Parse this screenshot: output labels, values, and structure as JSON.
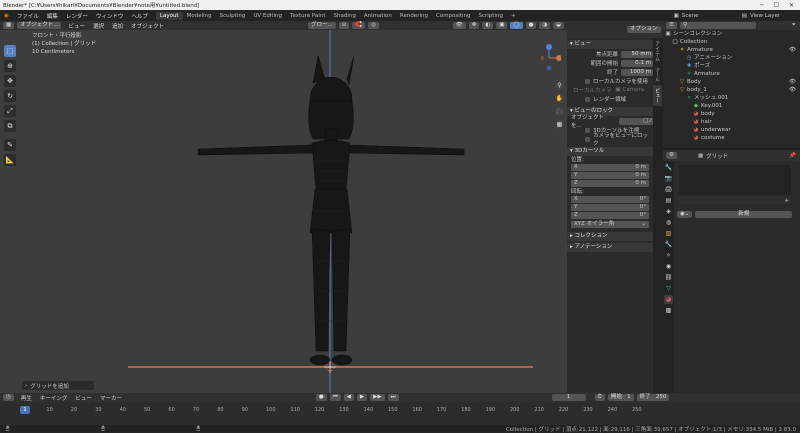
{
  "titlebar": {
    "title": "Blender* [C:¥Users¥hikari¥Documents¥Blender¥note用¥untitled.blend]"
  },
  "menu": [
    "ファイル",
    "編集",
    "レンダー",
    "ウィンドウ",
    "ヘルプ"
  ],
  "workspaces": [
    "Layout",
    "Modeling",
    "Sculpting",
    "UV Editing",
    "Texture Paint",
    "Shading",
    "Animation",
    "Rendering",
    "Compositing",
    "Scripting"
  ],
  "workspace_add": "+",
  "scene": {
    "label": "Scene",
    "view_layer": "View Layer",
    "options": "オプション"
  },
  "viewport": {
    "mode": "オブジェクト...",
    "menus": [
      "ビュー",
      "選択",
      "追加",
      "オブジェクト"
    ],
    "transform": "グロー...",
    "overlay_lines": [
      "フロント・平行投影",
      "(1) Collection | グリッド",
      "10 Centimeters"
    ],
    "add_grid": "グリッドを追加"
  },
  "npanel": {
    "view_header": "ビュー",
    "focal_label": "焦点距離",
    "focal_value": "50 mm",
    "clip_start_label": "範囲の開始",
    "clip_start_value": "0.1 m",
    "clip_end_label": "終了",
    "clip_end_value": "1000 m",
    "local_camera": "ローカルカメラを使用",
    "local_camera_label": "ローカルカメラ",
    "local_camera_value": "Camera",
    "render_region": "レンダー領域",
    "lock_header": "ビューのロック",
    "lock_object": "オブジェクトを...",
    "lock_cursor": "3Dカーソルを注視",
    "lock_camera": "カメラをビューにロック",
    "cursor_header": "3Dカーソル",
    "location_label": "位置:",
    "loc": [
      {
        "axis": "X",
        "value": "0 m"
      },
      {
        "axis": "Y",
        "value": "0 m"
      },
      {
        "axis": "Z",
        "value": "0 m"
      }
    ],
    "rotation_label": "回転:",
    "rot": [
      {
        "axis": "X",
        "value": "0°"
      },
      {
        "axis": "Y",
        "value": "0°"
      },
      {
        "axis": "Z",
        "value": "0°"
      }
    ],
    "rotation_mode": "XYZ オイラー角",
    "collection_header": "コレクション",
    "annotation_header": "アノテーション"
  },
  "ntabs": [
    "アイテム",
    "ツール",
    "ビュー"
  ],
  "outliner": {
    "title": "シーンコレクション",
    "items": [
      {
        "name": "Collection",
        "icon": "collection-icon",
        "indent": 1
      },
      {
        "name": "Armature",
        "icon": "armature-icon",
        "indent": 2
      },
      {
        "name": "アニメーション",
        "icon": "animation-icon",
        "indent": 3
      },
      {
        "name": "ポーズ",
        "icon": "pose-icon",
        "indent": 3
      },
      {
        "name": "Armature",
        "icon": "armature-data-icon",
        "indent": 3
      },
      {
        "name": "Body",
        "icon": "mesh-icon",
        "indent": 2
      },
      {
        "name": "body_1",
        "icon": "mesh-icon",
        "indent": 2
      },
      {
        "name": "メッシュ.001",
        "icon": "mesh-data-icon",
        "indent": 3
      },
      {
        "name": "Key.001",
        "icon": "shapekey-icon",
        "indent": 4
      },
      {
        "name": "body",
        "icon": "material-icon",
        "indent": 4
      },
      {
        "name": "hair",
        "icon": "material-icon",
        "indent": 4
      },
      {
        "name": "underwear",
        "icon": "material-icon",
        "indent": 4
      },
      {
        "name": "costume",
        "icon": "material-icon",
        "indent": 4
      }
    ]
  },
  "properties": {
    "object_name": "グリッド",
    "new_button": "新規"
  },
  "timeline": {
    "menus": [
      "再生",
      "キーイング",
      "ビュー",
      "マーカー"
    ],
    "current_frame": "1",
    "start_label": "開始",
    "start_value": "1",
    "end_label": "終了",
    "end_value": "250",
    "ticks": [
      "0",
      "10",
      "20",
      "30",
      "40",
      "50",
      "60",
      "70",
      "80",
      "90",
      "100",
      "110",
      "120",
      "130",
      "140",
      "150",
      "160",
      "170",
      "180",
      "190",
      "200",
      "210",
      "220",
      "230",
      "240",
      "250"
    ]
  },
  "statusbar": {
    "text": "Collection | グリッド | 頂点:21,122 | 面:29,116 | 三角面:39,657 | オブジェクト:1/3 | メモリ:334.5 MiB | 2.83.0"
  },
  "colors": {
    "accent": "#5680c2",
    "axis_x": "#d6754a",
    "axis_z": "#5b7fd6",
    "wire": "#111111"
  }
}
